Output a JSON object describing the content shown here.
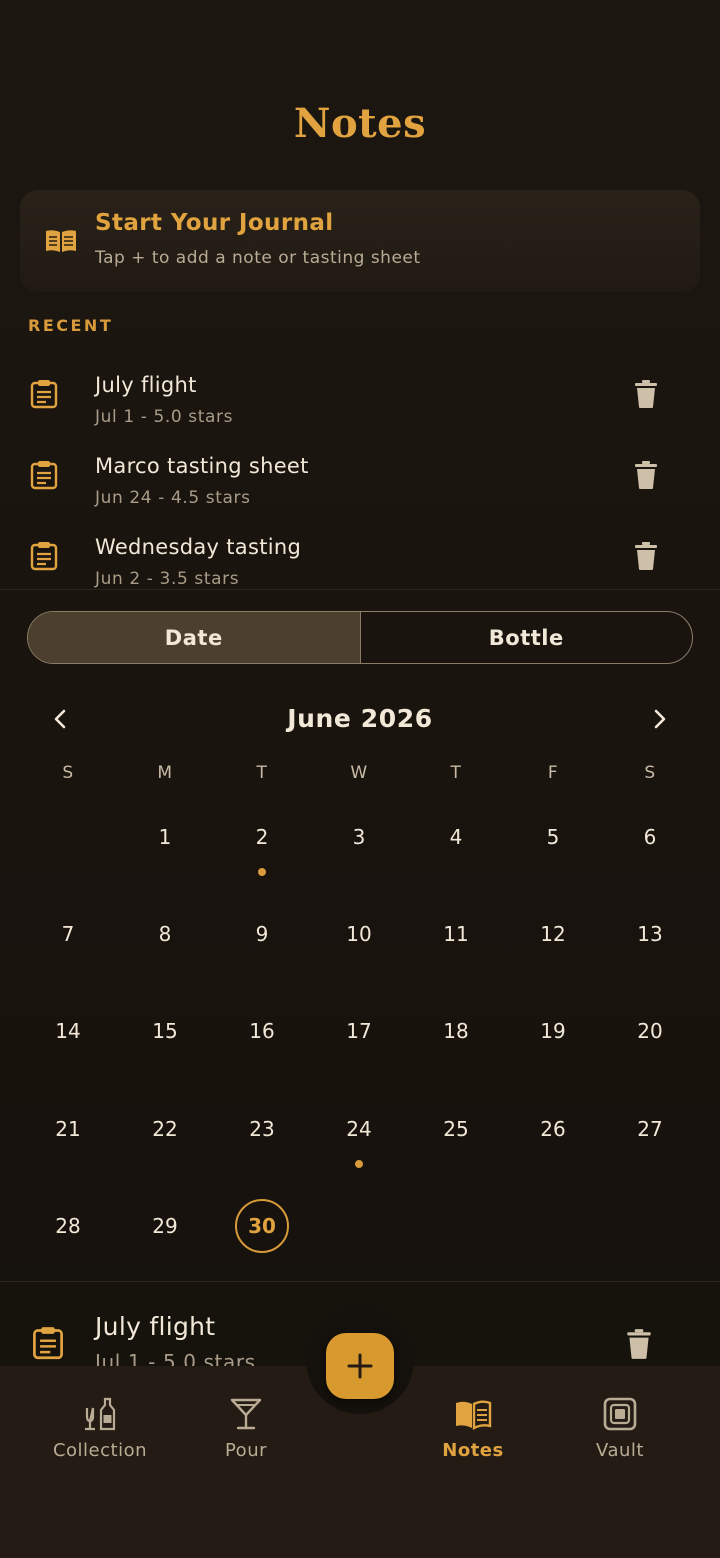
{
  "header": {
    "title": "Notes"
  },
  "journal": {
    "title": "Start Your Journal",
    "subtitle": "Tap + to add a note or tasting sheet",
    "icon": "open-book-icon"
  },
  "recent": {
    "label": "RECENT",
    "items": [
      {
        "title": "July flight",
        "subtitle": "Jul 1 - 5.0 stars"
      },
      {
        "title": "Marco tasting sheet",
        "subtitle": "Jun 24 - 4.5 stars"
      },
      {
        "title": "Wednesday tasting",
        "subtitle": "Jun 2 - 3.5 stars"
      }
    ]
  },
  "segmented": {
    "date_label": "Date",
    "bottle_label": "Bottle",
    "selected": "Date"
  },
  "calendar": {
    "month_title": "June 2026",
    "weekdays": [
      "S",
      "M",
      "T",
      "W",
      "T",
      "F",
      "S"
    ],
    "days": [
      "1",
      "2",
      "3",
      "4",
      "5",
      "6",
      "7",
      "8",
      "9",
      "10",
      "11",
      "12",
      "13",
      "14",
      "15",
      "16",
      "17",
      "18",
      "19",
      "20",
      "21",
      "22",
      "23",
      "24",
      "25",
      "26",
      "27",
      "28",
      "29",
      "30"
    ],
    "today": "30",
    "marked_days": [
      "2",
      "24"
    ]
  },
  "selected_note": {
    "title": "July flight",
    "subtitle": "Jul 1 - 5.0 stars"
  },
  "tabbar": {
    "tabs": [
      {
        "label": "Collection",
        "icon": "bottles-icon"
      },
      {
        "label": "Pour",
        "icon": "cocktail-glass-icon"
      },
      {
        "label": "Notes",
        "icon": "open-book-icon"
      },
      {
        "label": "Vault",
        "icon": "safe-icon"
      }
    ],
    "active": "Notes",
    "fab_icon": "plus-icon"
  },
  "colors": {
    "accent": "#e0a33f",
    "background": "#1a150f",
    "text": "#f2e8d8",
    "muted": "#a89c88"
  }
}
